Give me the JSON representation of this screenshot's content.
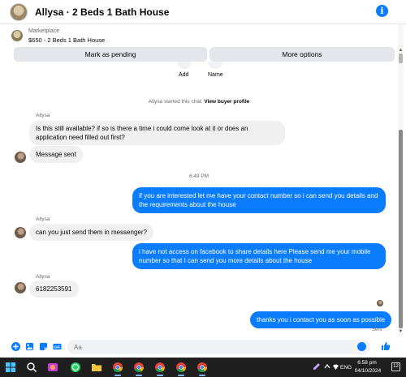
{
  "header": {
    "title": "Allysa · 2 Beds 1 Bath House",
    "info_icon": "i"
  },
  "listing": {
    "context": "Marketplace",
    "description": "$650 - 2 Beds 1 Bath House"
  },
  "actions": {
    "mark_pending": "Mark as pending",
    "more_options": "More options"
  },
  "quick_actions": {
    "add": "Add",
    "name": "Name"
  },
  "chat": {
    "started_note": "Allysa started this chat.",
    "view_profile": "View buyer profile",
    "messages": {
      "m1_sender": "Allysa",
      "m1_text": "Is this still available? if so is there a time i could come look at it or does an application need filled out first?",
      "m2_text": "Message sent",
      "time_divider": "6:49 PM",
      "m3_text": "if you are interested let me have your contact number so i can send you details and the requirements about the house",
      "m4_sender": "Allysa",
      "m4_text": "can you just send them in messenger?",
      "m5_text": "i have not access on facebook to share details here Please send me your mobile number so that I can send you more details about the house",
      "m6_sender": "Allysa",
      "m6_text": "6182253591",
      "m7_text": "thanks you i contact you as soon as possible",
      "status": "Sent"
    }
  },
  "composer": {
    "placeholder": "Aa"
  },
  "taskbar": {
    "time": "6:58 pm",
    "date": "04/10/2024",
    "lang": "ENG",
    "notif_count": "12"
  },
  "colors": {
    "accent": "#0a7cff",
    "bubble_in": "#f0f0f0",
    "taskbar": "#1f1f1f"
  }
}
